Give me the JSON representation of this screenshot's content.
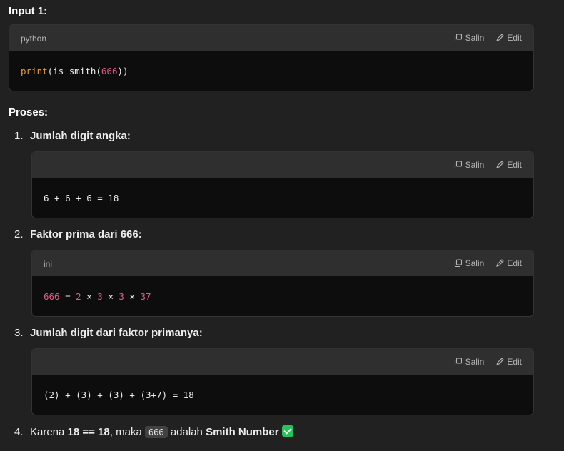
{
  "input_heading": "Input 1:",
  "actions": {
    "copy_label": "Salin",
    "edit_label": "Edit"
  },
  "block1": {
    "lang": "python",
    "fn": "print",
    "open": "(is_smith(",
    "num": "666",
    "close": "))"
  },
  "proses_heading": "Proses:",
  "steps": [
    {
      "num": "1.",
      "label": "Jumlah digit angka:"
    },
    {
      "num": "2.",
      "label": "Faktor prima dari 666:"
    },
    {
      "num": "3.",
      "label": "Jumlah digit dari faktor primanya:"
    }
  ],
  "block2": {
    "lang": "",
    "code": "6 + 6 + 6 = 18"
  },
  "block3": {
    "lang": "ini",
    "n666": "666",
    "eq": " = ",
    "n2": "2",
    "x1": " × ",
    "n3a": "3",
    "x2": " × ",
    "n3b": "3",
    "x3": " × ",
    "n37": "37"
  },
  "block4": {
    "lang": "",
    "code": "(2) + (3) + (3) + (3+7) = 18"
  },
  "step4": {
    "num": "4.",
    "prefix": "Karena ",
    "expr": "18 == 18",
    "mid": ", maka ",
    "inline_code": "666",
    "adalah": " adalah ",
    "result": "Smith Number"
  },
  "colors": {
    "background": "#212121",
    "code_bg": "#0d0d0d",
    "header_bg": "#2f2f2f",
    "keyword": "#e69d3c",
    "number": "#e05a80",
    "check": "#25c35a"
  }
}
